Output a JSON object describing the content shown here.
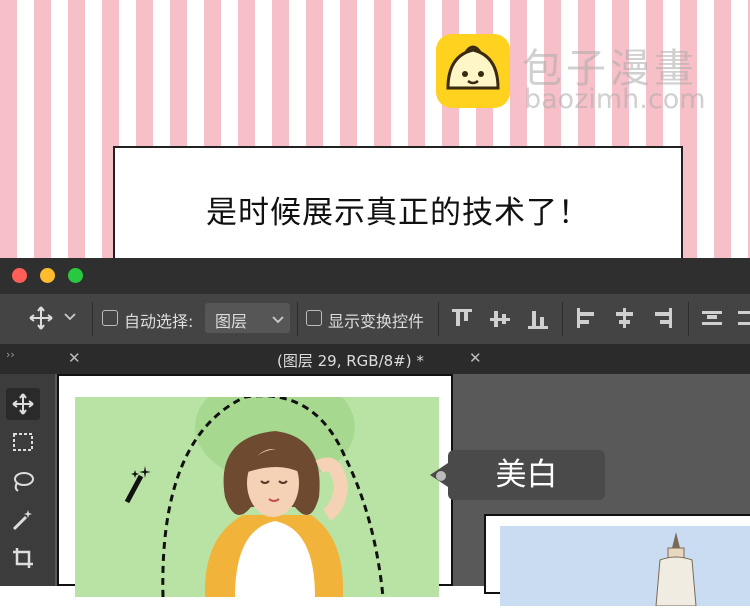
{
  "watermark": {
    "name_cn": "包子漫畫",
    "domain": "baozimh.com"
  },
  "caption": {
    "text": "是时候展示真正的技术了！"
  },
  "options_bar": {
    "auto_select_label": "自动选择:",
    "auto_select_target": "图层",
    "show_transform_label": "显示变换控件"
  },
  "tabbar": {
    "doc_title": "(图层 29, RGB/8#) *"
  },
  "tooltip": {
    "text": "美白"
  },
  "colors": {
    "stripe_pink": "#f7c0c8",
    "ps_dark": "#3c3c3c",
    "canvas_green": "#b9e3a4"
  }
}
